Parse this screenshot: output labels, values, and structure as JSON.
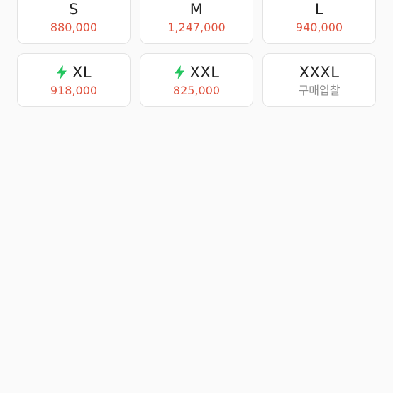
{
  "colors": {
    "price": "#e0533f",
    "bid_label": "#8c8c8c",
    "fast_delivery_icon": "#22c55e"
  },
  "sizes": [
    {
      "label": "S",
      "price": "880,000",
      "fast": false
    },
    {
      "label": "M",
      "price": "1,247,000",
      "fast": false
    },
    {
      "label": "L",
      "price": "940,000",
      "fast": false
    },
    {
      "label": "XL",
      "price": "918,000",
      "fast": true,
      "icon": "lightning-bolt"
    },
    {
      "label": "XXL",
      "price": "825,000",
      "fast": true,
      "icon": "lightning-bolt"
    },
    {
      "label": "XXXL",
      "price": "구매입찰",
      "fast": false
    }
  ]
}
